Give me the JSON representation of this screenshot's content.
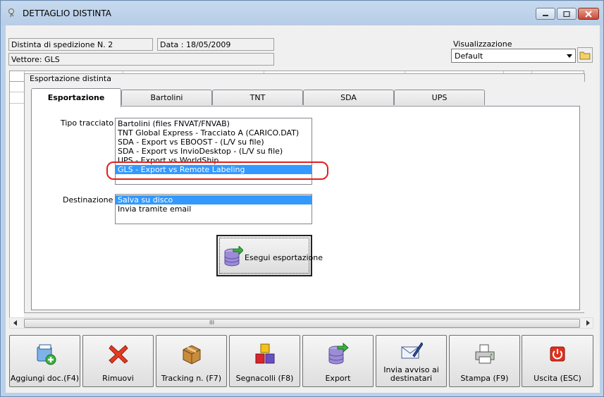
{
  "window": {
    "title": "DETTAGLIO DISTINTA",
    "controls": {
      "minimize": "–",
      "maximize": "□",
      "close": "✕"
    }
  },
  "header": {
    "distinta": "Distinta di spedizione N. 2",
    "data": "Data : 18/05/2009",
    "vettore": "Vettore: GLS",
    "visualizzazione_label": "Visualizzazione",
    "visualizzazione_value": "Default"
  },
  "export_group": {
    "title": "Esportazione distinta",
    "tabs": [
      "Esportazione",
      "Bartolini",
      "TNT",
      "SDA",
      "UPS"
    ],
    "active_tab": "Esportazione",
    "tipo_label": "Tipo tracciato :",
    "tipo_items": [
      "Bartolini (files FNVAT/FNVAB)",
      "TNT Global Express - Tracciato A (CARICO.DAT)",
      "SDA - Export vs EBOOST - (L/V su file)",
      "SDA - Export vs InvioDesktop - (L/V su file)",
      "UPS - Export vs WorldShip",
      "GLS - Export vs Remote Labeling"
    ],
    "tipo_selected": "GLS - Export vs Remote Labeling",
    "dest_label": "Destinazione :",
    "dest_items": [
      "Salva su disco",
      "Invia tramite email"
    ],
    "dest_selected": "Salva su disco",
    "exec_label": "Esegui esportazione"
  },
  "scrollbar": {
    "grip": "III"
  },
  "toolbar": [
    {
      "label": "Aggiungi doc.(F4)",
      "icon": "add-document-icon"
    },
    {
      "label": "Rimuovi",
      "icon": "remove-x-icon"
    },
    {
      "label": "Tracking n. (F7)",
      "icon": "package-icon"
    },
    {
      "label": "Segnacolli (F8)",
      "icon": "boxes-icon"
    },
    {
      "label": "Export",
      "icon": "database-export-icon"
    },
    {
      "label": "Invia avviso ai destinatari",
      "icon": "mail-pen-icon"
    },
    {
      "label": "Stampa (F9)",
      "icon": "printer-icon"
    },
    {
      "label": "Uscita (ESC)",
      "icon": "power-exit-icon"
    }
  ],
  "colors": {
    "selection": "#3399ff",
    "highlight_ring": "#e0201c",
    "titlebar": "#b9d1ea"
  }
}
